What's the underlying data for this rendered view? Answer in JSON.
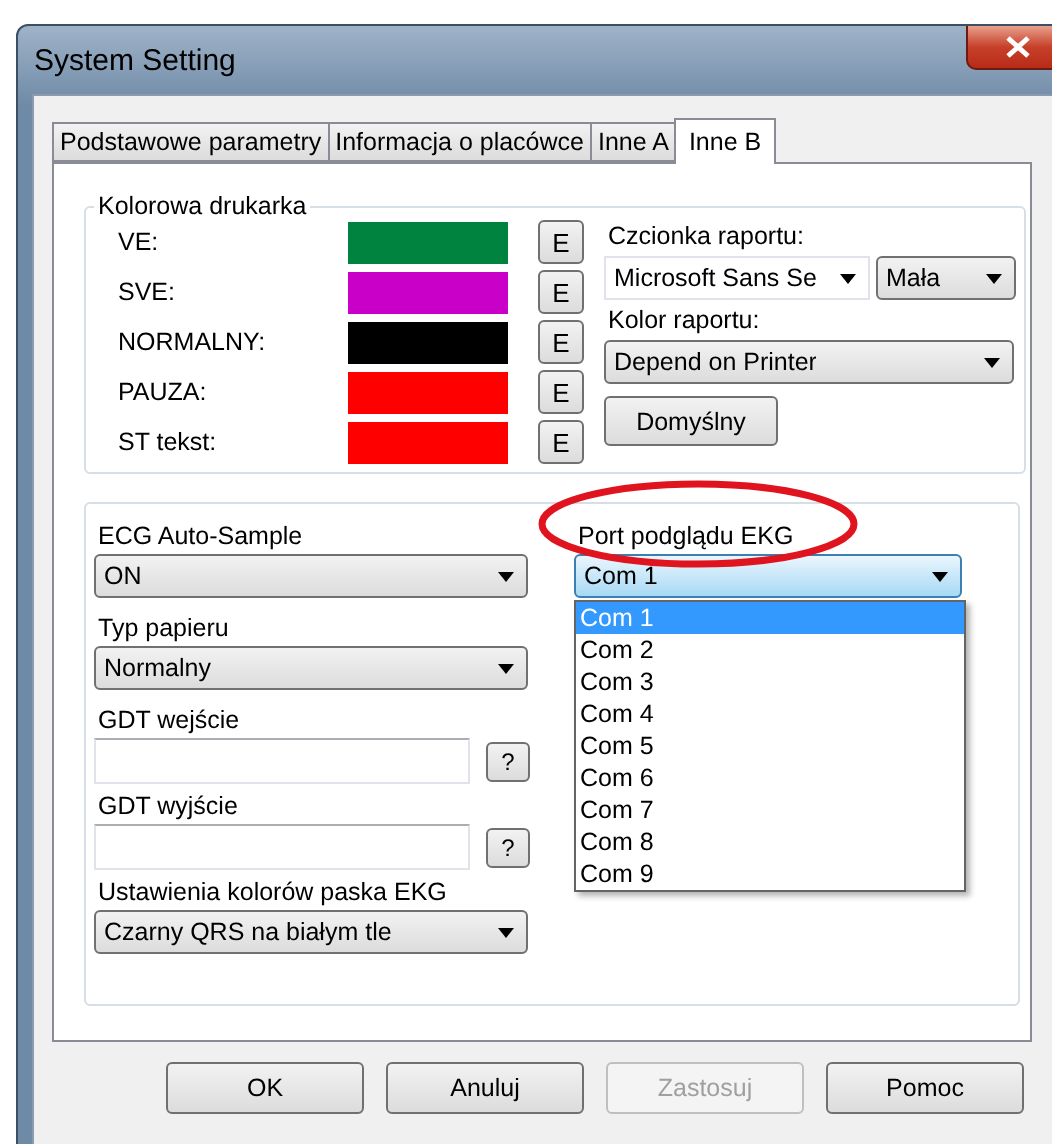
{
  "window": {
    "title": "System Setting"
  },
  "tabs": [
    {
      "label": "Podstawowe parametry",
      "selected": false
    },
    {
      "label": "Informacja o placówce",
      "selected": false
    },
    {
      "label": "Inne A",
      "selected": false
    },
    {
      "label": "Inne B",
      "selected": true
    }
  ],
  "printer_group": {
    "title": "Kolorowa drukarka",
    "colors": [
      {
        "label": "VE:",
        "color": "#00833f",
        "button": "E"
      },
      {
        "label": "SVE:",
        "color": "#c800c8",
        "button": "E"
      },
      {
        "label": "NORMALNY:",
        "color": "#000000",
        "button": "E"
      },
      {
        "label": "PAUZA:",
        "color": "#ff0000",
        "button": "E"
      },
      {
        "label": "ST tekst:",
        "color": "#ff0000",
        "button": "E"
      }
    ],
    "font_label": "Czcionka raportu:",
    "font_value": "Microsoft Sans Se",
    "size_value": "Mała",
    "report_color_label": "Kolor raportu:",
    "report_color_value": "Depend on Printer",
    "default_button": "Domyślny"
  },
  "left_fields": [
    {
      "kind": "combo",
      "label": "ECG Auto-Sample",
      "value": "ON"
    },
    {
      "kind": "combo",
      "label": "Typ papieru",
      "value": "Normalny"
    },
    {
      "kind": "text",
      "label": "GDT wejście",
      "button": "?"
    },
    {
      "kind": "text",
      "label": "GDT wyjście",
      "button": "?"
    },
    {
      "kind": "combo",
      "label": "Ustawienia kolorów paska EKG",
      "value": "Czarny QRS na białym tle"
    }
  ],
  "port": {
    "label": "Port podglądu EKG",
    "highlighted": true,
    "value": "Com 1",
    "expanded": true,
    "options": [
      {
        "label": "Com 1",
        "selected": true
      },
      {
        "label": "Com 2",
        "selected": false
      },
      {
        "label": "Com 3",
        "selected": false
      },
      {
        "label": "Com 4",
        "selected": false
      },
      {
        "label": "Com 5",
        "selected": false
      },
      {
        "label": "Com 6",
        "selected": false
      },
      {
        "label": "Com 7",
        "selected": false
      },
      {
        "label": "Com 8",
        "selected": false
      },
      {
        "label": "Com 9",
        "selected": false
      }
    ]
  },
  "buttons": [
    {
      "label": "OK",
      "disabled": false
    },
    {
      "label": "Anuluj",
      "disabled": false
    },
    {
      "label": "Zastosuj",
      "disabled": true
    },
    {
      "label": "Pomoc",
      "disabled": false
    }
  ]
}
